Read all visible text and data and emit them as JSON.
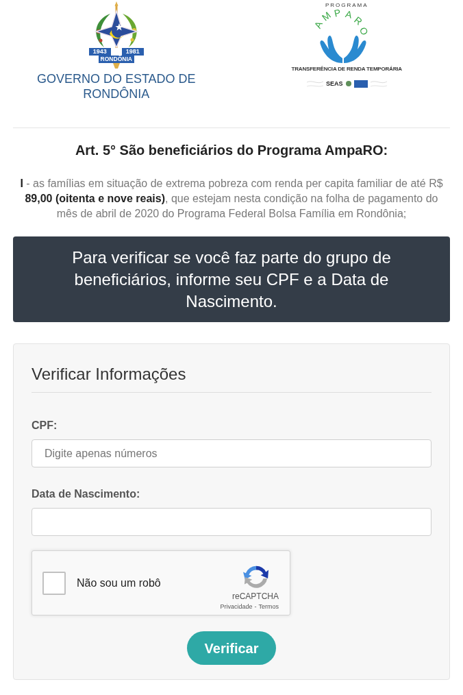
{
  "header": {
    "state_logo": {
      "emblem_years": [
        "1943",
        "1981"
      ],
      "emblem_banner": "RONDÔNIA",
      "caption": "GOVERNO DO ESTADO DE RONDÔNIA"
    },
    "program_logo": {
      "overline": "PROGRAMA",
      "wordmark": "AMPARO",
      "tagline": "TRANSFERÊNCIA DE RENDA TEMPORÁRIA",
      "partner": "SEAS"
    }
  },
  "article": {
    "title": "Art. 5° São beneficiários do Programa AmpaRO:",
    "text": "**I** - as famílias em situação de extrema pobreza com renda per capita familiar de até R$ **89,00 (oitenta e nove reais)**, que estejam nesta condição na folha de pagamento do mês de abril de 2020 do Programa Federal Bolsa Família em Rondônia;"
  },
  "notice": "Para verificar se você faz parte do grupo de beneficiários, informe seu CPF e a Data de Nascimento.",
  "form": {
    "title": "Verificar Informações",
    "fields": [
      {
        "label": "CPF:",
        "placeholder": "Digite apenas números"
      },
      {
        "label": "Data de Nascimento:"
      }
    ],
    "captcha": {
      "label": "Não sou um robô",
      "checked": false,
      "brand": "reCAPTCHA",
      "privacy": "Privacidade",
      "separator": "-",
      "terms": "Termos"
    },
    "submit": "Verificar"
  }
}
